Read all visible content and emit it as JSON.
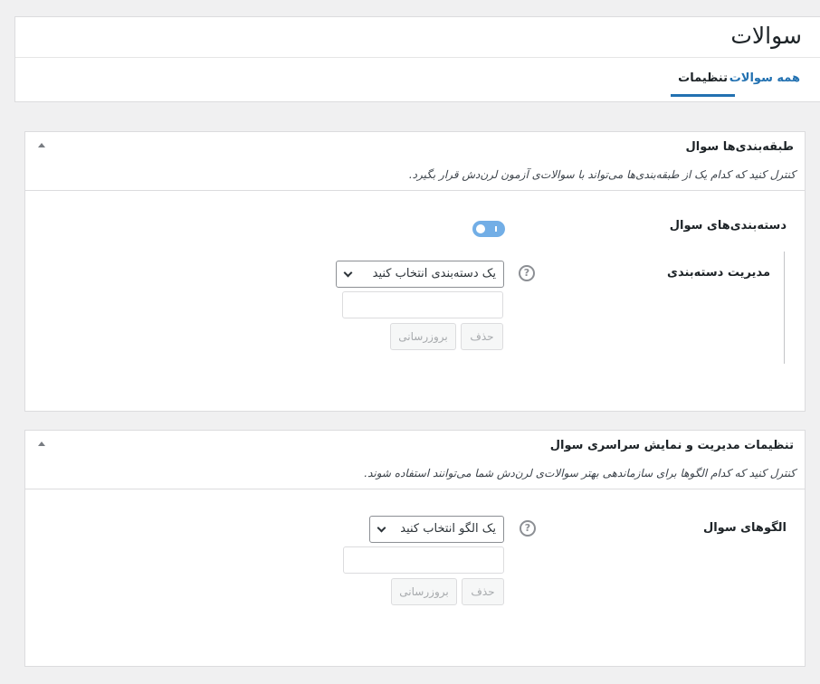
{
  "header": {
    "title": "سوالات",
    "tabs": [
      {
        "label": "همه سوالات"
      },
      {
        "label": "تنظیمات"
      }
    ]
  },
  "panels": [
    {
      "title": "طبقه‌بندی‌ها سوال",
      "description": "کنترل کنید که کدام یک از طبقه‌بندی‌ها می‌تواند با سوالات‌ی آزمون لرن‌دش قرار بگیرد.",
      "toggle_label": "دسته‌بندی‌های سوال",
      "toggle_state": "off",
      "manage_label": "مدیریت دسته‌بندی",
      "help_icon": "?",
      "select_value": "یک دسته‌بندی انتخاب کنید",
      "input_value": "",
      "delete_label": "حذف",
      "update_label": "بروزرسانی"
    },
    {
      "title": "تنظیمات مدیریت و نمایش سراسری سوال",
      "description": "کنترل کنید که کدام الگوها برای سازماندهی بهتر سوالات‌ی لرن‌دش شما می‌توانند استفاده شوند.",
      "field_label": "الگوهای سوال",
      "help_icon": "?",
      "select_value": "یک الگو انتخاب کنید",
      "input_value": "",
      "delete_label": "حذف",
      "update_label": "بروزرسانی"
    }
  ],
  "colors": {
    "accent": "#2271b1",
    "toggle": "#72aee6",
    "background": "#f0f0f1"
  }
}
